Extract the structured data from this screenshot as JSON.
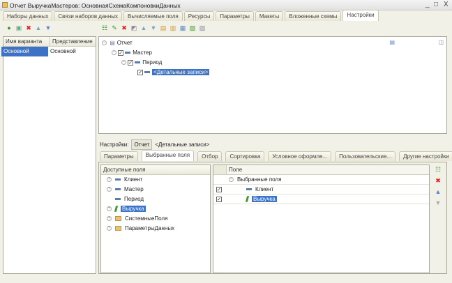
{
  "window": {
    "title": "Отчет ВыручкаМастеров: ОсновнаяСхемаКомпоновкиДанных",
    "minimize": "_",
    "maximize": "□",
    "close": "X"
  },
  "tabs": [
    "Наборы данных",
    "Связи наборов данных",
    "Вычисляемые поля",
    "Ресурсы",
    "Параметры",
    "Макеты",
    "Вложенные схемы",
    "Настройки"
  ],
  "active_tab": "Настройки",
  "variants": {
    "columns": [
      "Имя варианта",
      "Представление"
    ],
    "rows": [
      [
        "Основной",
        "Основной"
      ]
    ]
  },
  "structure_tree": [
    {
      "label": "Отчет",
      "level": 0,
      "icon": "report-icon"
    },
    {
      "label": "Мастер",
      "level": 1,
      "checked": true,
      "icon": "grouping-icon"
    },
    {
      "label": "Период",
      "level": 2,
      "checked": true,
      "icon": "grouping-icon"
    },
    {
      "label": "<Детальные записи>",
      "level": 3,
      "checked": true,
      "icon": "grouping-icon",
      "selected": true
    }
  ],
  "settings": {
    "label": "Настройки:",
    "buttons": [
      "Отчет",
      "<Детальные записи>"
    ]
  },
  "settings_tabs": [
    "Параметры",
    "Выбранные поля",
    "Отбор",
    "Сортировка",
    "Условное оформле...",
    "Пользовательские...",
    "Другие настройки"
  ],
  "active_settings_tab": "Выбранные поля",
  "available_fields": {
    "header": "Доступные поля",
    "items": [
      {
        "label": "Клиент",
        "expandable": true,
        "icon": "field-icon"
      },
      {
        "label": "Мастер",
        "expandable": true,
        "icon": "field-icon"
      },
      {
        "label": "Период",
        "expandable": false,
        "icon": "field-icon"
      },
      {
        "label": "Выручка",
        "expandable": true,
        "icon": "resource-icon",
        "selected": true
      },
      {
        "label": "СистемныеПоля",
        "expandable": true,
        "icon": "folder-icon"
      },
      {
        "label": "ПараметрыДанных",
        "expandable": true,
        "icon": "folder-icon"
      }
    ]
  },
  "selected_fields": {
    "header": "Поле",
    "group": "Выбранные поля",
    "items": [
      {
        "label": "Клиент",
        "checked": true,
        "icon": "field-icon"
      },
      {
        "label": "Выручка",
        "checked": true,
        "icon": "resource-icon",
        "selected": true
      }
    ]
  },
  "colors": {
    "selection": "#3d72c4",
    "background": "#f2f1e8"
  }
}
